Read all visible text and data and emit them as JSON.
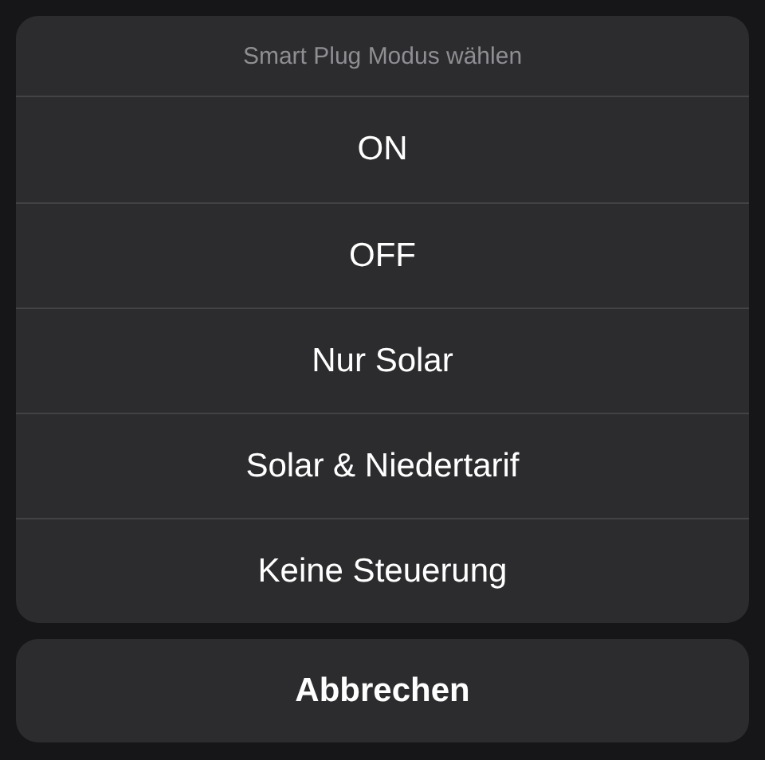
{
  "action_sheet": {
    "title": "Smart Plug Modus wählen",
    "options": [
      {
        "label": "ON"
      },
      {
        "label": "OFF"
      },
      {
        "label": "Nur Solar"
      },
      {
        "label": "Solar & Niedertarif"
      },
      {
        "label": "Keine Steuerung"
      }
    ],
    "cancel": {
      "label": "Abbrechen"
    }
  }
}
